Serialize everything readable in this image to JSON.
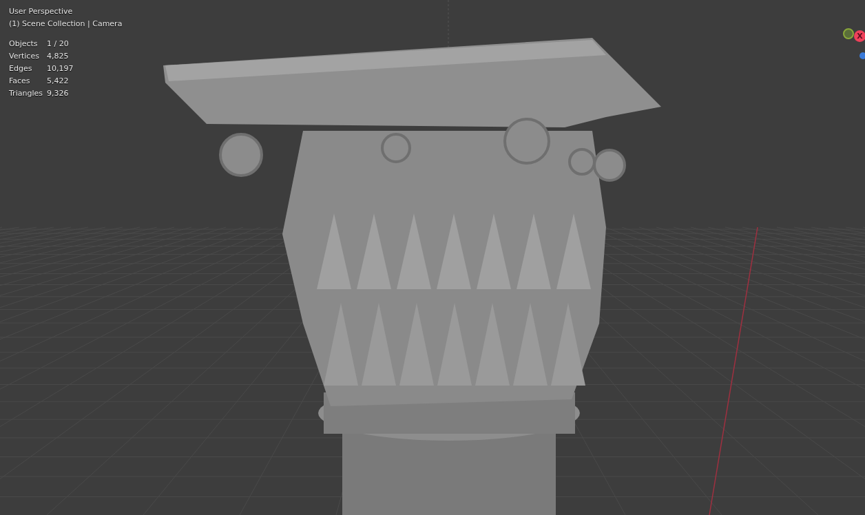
{
  "viewport": {
    "view_name": "User Perspective",
    "collection": "(1) Scene Collection | Camera",
    "stats": [
      {
        "label": "Objects",
        "value": "1 / 20"
      },
      {
        "label": "Vertices",
        "value": "4,825"
      },
      {
        "label": "Edges",
        "value": "10,197"
      },
      {
        "label": "Faces",
        "value": "5,422"
      },
      {
        "label": "Triangles",
        "value": "9,326"
      }
    ]
  },
  "gizmo": {
    "x_label": "X"
  }
}
